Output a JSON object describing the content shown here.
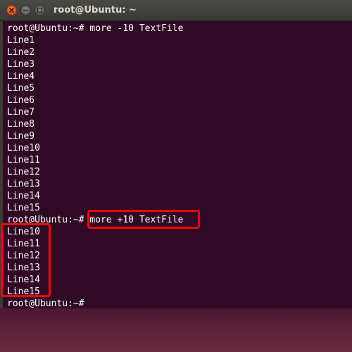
{
  "window": {
    "title": "root@Ubuntu: ~"
  },
  "terminal": {
    "lines": [
      "root@Ubuntu:~# more -10 TextFile",
      "Line1",
      "Line2",
      "Line3",
      "Line4",
      "Line5",
      "Line6",
      "Line7",
      "Line8",
      "Line9",
      "Line10",
      "Line11",
      "Line12",
      "Line13",
      "Line14",
      "Line15",
      "root@Ubuntu:~# more +10 TextFile",
      "Line10",
      "Line11",
      "Line12",
      "Line13",
      "Line14",
      "Line15",
      "root@Ubuntu:~#"
    ]
  },
  "colors": {
    "terminal_bg": "#300a24",
    "text": "#ffffff",
    "highlight": "#ff0000",
    "close_button": "#e0541f"
  },
  "icons": [
    "close-icon",
    "minimize-icon",
    "maximize-icon"
  ]
}
